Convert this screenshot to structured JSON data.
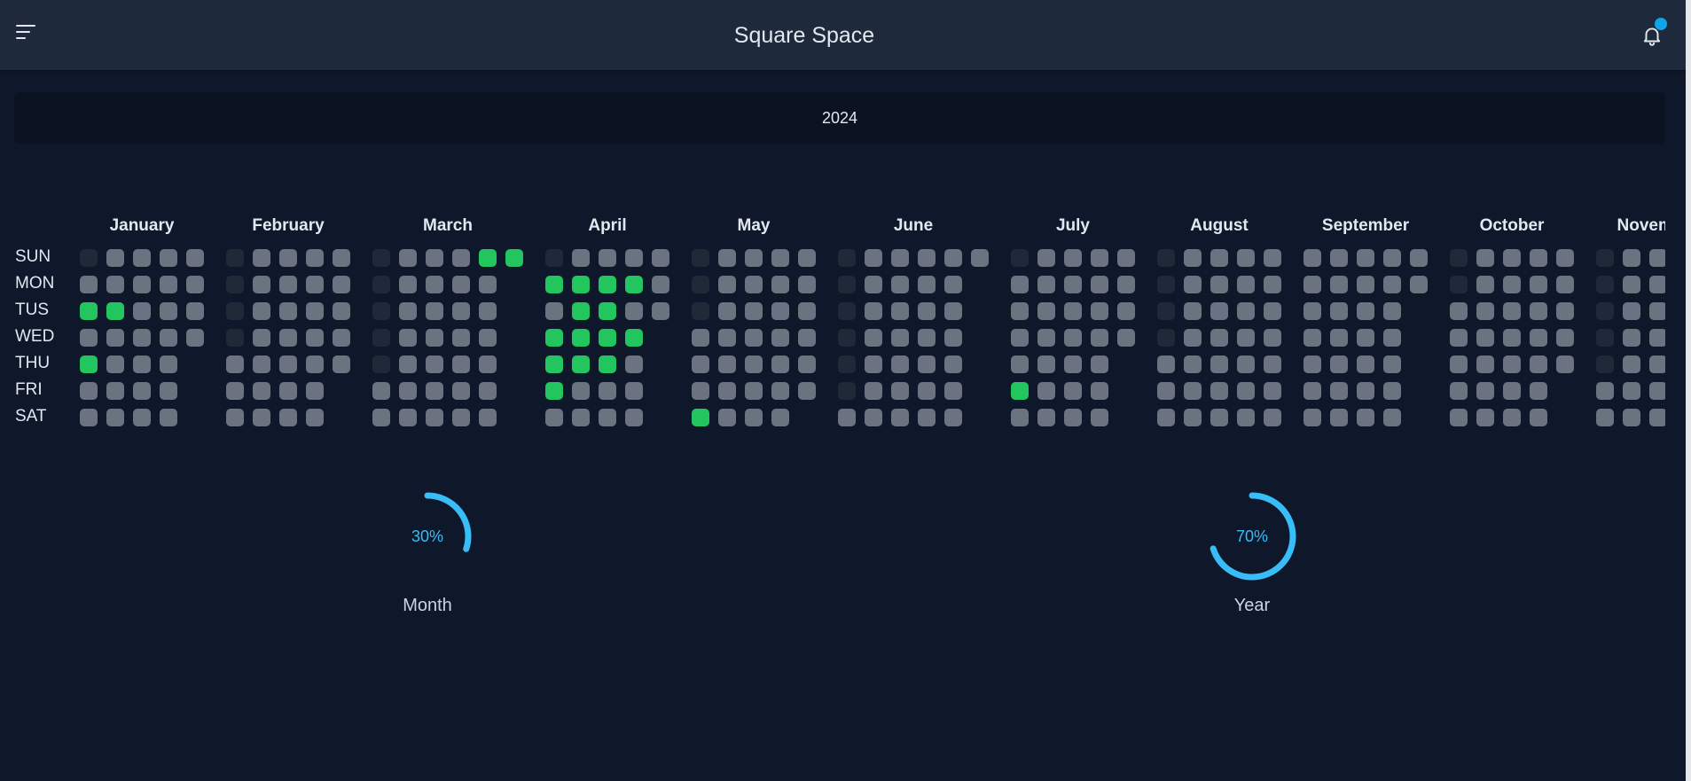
{
  "app": {
    "title": "Square Space"
  },
  "icons": {
    "menu": "menu-icon",
    "bell": "bell-icon"
  },
  "colors": {
    "active": "#22c55e",
    "inactive": "#6b7280",
    "empty": "#1f2937",
    "accent": "#38bdf8",
    "badge": "#0ea5e9"
  },
  "year": "2024",
  "days": [
    "SUN",
    "MON",
    "TUS",
    "WED",
    "THU",
    "FRI",
    "SAT"
  ],
  "months": [
    {
      "name": "January",
      "start": 1,
      "length": 31,
      "active": [
        2,
        4,
        9
      ]
    },
    {
      "name": "February",
      "start": 4,
      "length": 29,
      "active": []
    },
    {
      "name": "March",
      "start": 5,
      "length": 31,
      "active": [
        24,
        31
      ]
    },
    {
      "name": "April",
      "start": 1,
      "length": 30,
      "active": [
        1,
        3,
        4,
        5,
        8,
        9,
        10,
        11,
        15,
        16,
        17,
        18,
        22,
        24
      ]
    },
    {
      "name": "May",
      "start": 3,
      "length": 31,
      "active": [
        4
      ]
    },
    {
      "name": "June",
      "start": 6,
      "length": 30,
      "active": []
    },
    {
      "name": "July",
      "start": 1,
      "length": 31,
      "active": [
        5
      ]
    },
    {
      "name": "August",
      "start": 4,
      "length": 31,
      "active": []
    },
    {
      "name": "September",
      "start": 0,
      "length": 30,
      "active": []
    },
    {
      "name": "October",
      "start": 2,
      "length": 31,
      "active": []
    },
    {
      "name": "November",
      "start": 5,
      "length": 30,
      "active": []
    }
  ],
  "progress": [
    {
      "label": "Month",
      "value": 30,
      "text": "30%"
    },
    {
      "label": "Year",
      "value": 70,
      "text": "70%"
    }
  ]
}
